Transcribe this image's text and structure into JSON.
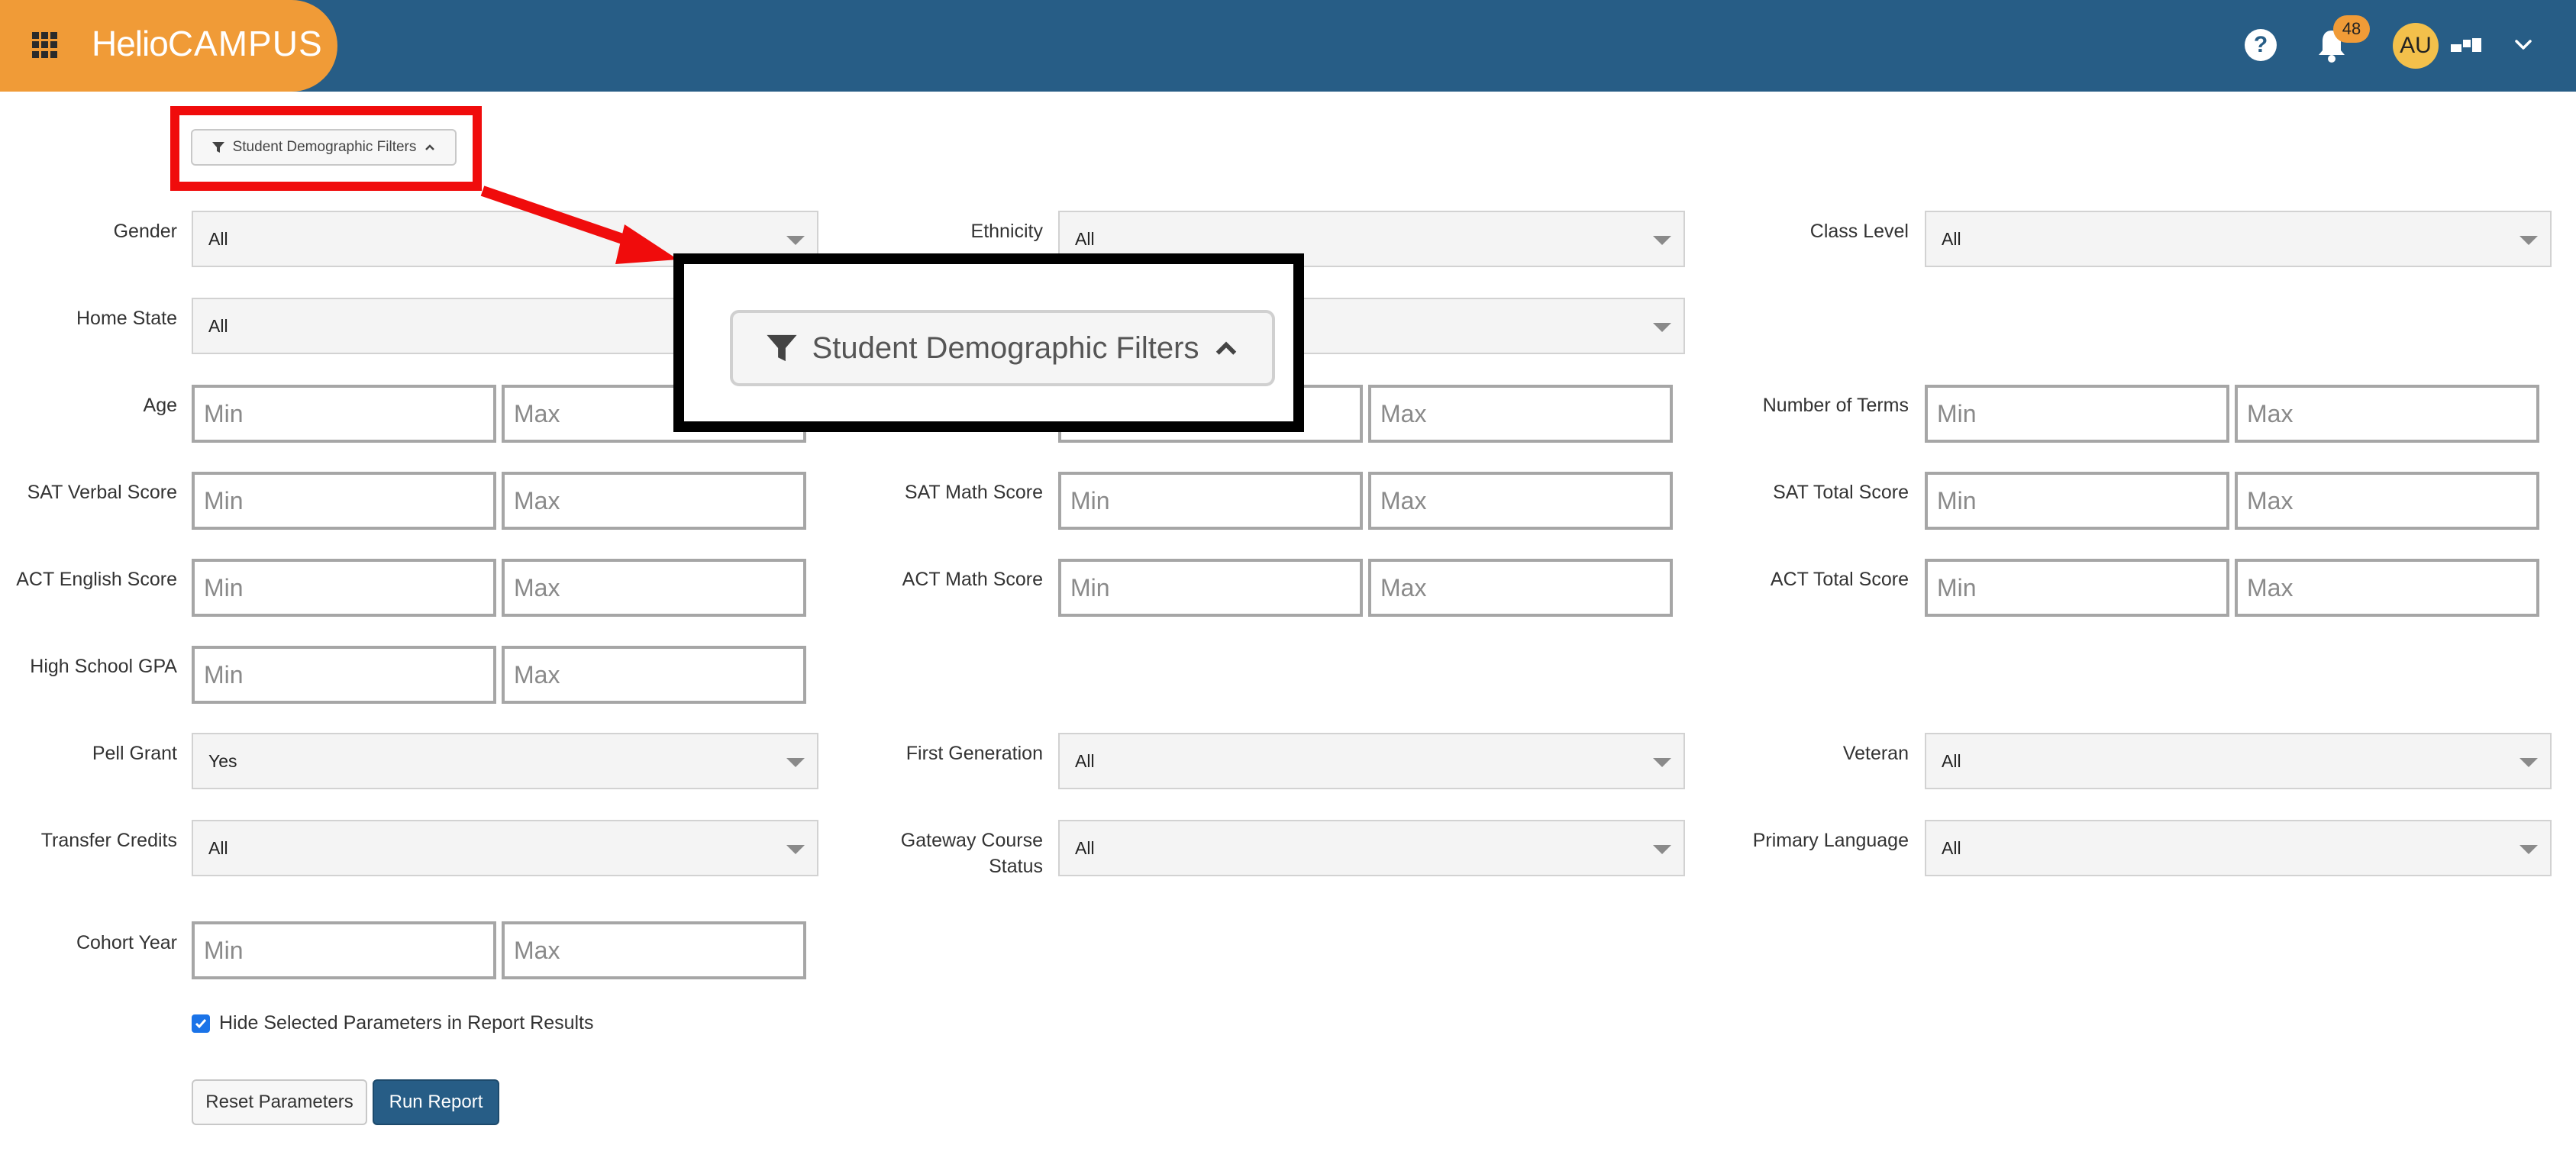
{
  "header": {
    "logo_bold": "Helio",
    "logo_light": "CAMPUS",
    "notification_count": "48",
    "avatar_initials": "AU",
    "colors": {
      "primary": "#275d86",
      "accent": "#f09b37",
      "avatar": "#f3c04b"
    }
  },
  "filters_toggle": {
    "label": "Student Demographic Filters"
  },
  "zoom_callout": {
    "label": "Student Demographic Filters"
  },
  "fields": {
    "gender": {
      "label": "Gender",
      "value": "All"
    },
    "ethnicity": {
      "label": "Ethnicity",
      "value": "All"
    },
    "class_level": {
      "label": "Class Level",
      "value": "All"
    },
    "home_state": {
      "label": "Home State",
      "value": "All"
    },
    "age": {
      "label": "Age",
      "min": "Min",
      "max": "Max"
    },
    "number_of_terms": {
      "label": "Number of Terms",
      "min": "Min",
      "max": "Max"
    },
    "sat_verbal": {
      "label": "SAT Verbal Score",
      "min": "Min",
      "max": "Max"
    },
    "sat_math": {
      "label": "SAT Math Score",
      "min": "Min",
      "max": "Max"
    },
    "sat_total": {
      "label": "SAT Total Score",
      "min": "Min",
      "max": "Max"
    },
    "act_english": {
      "label": "ACT English Score",
      "min": "Min",
      "max": "Max"
    },
    "act_math": {
      "label": "ACT Math Score",
      "min": "Min",
      "max": "Max"
    },
    "act_total": {
      "label": "ACT Total Score",
      "min": "Min",
      "max": "Max"
    },
    "hs_gpa": {
      "label": "High School GPA",
      "min": "Min",
      "max": "Max"
    },
    "pell_grant": {
      "label": "Pell Grant",
      "value": "Yes"
    },
    "first_generation": {
      "label": "First Generation",
      "value": "All"
    },
    "veteran": {
      "label": "Veteran",
      "value": "All"
    },
    "transfer_credits": {
      "label": "Transfer Credits",
      "value": "All"
    },
    "gateway_course_status": {
      "label_line1": "Gateway Course",
      "label_line2": "Status",
      "value": "All"
    },
    "primary_language": {
      "label": "Primary Language",
      "value": "All"
    },
    "cohort_year": {
      "label": "Cohort Year",
      "min": "Min",
      "max": "Max"
    }
  },
  "hide_params": {
    "label": "Hide Selected Parameters in Report Results",
    "checked": true
  },
  "buttons": {
    "reset": "Reset Parameters",
    "run": "Run Report"
  }
}
